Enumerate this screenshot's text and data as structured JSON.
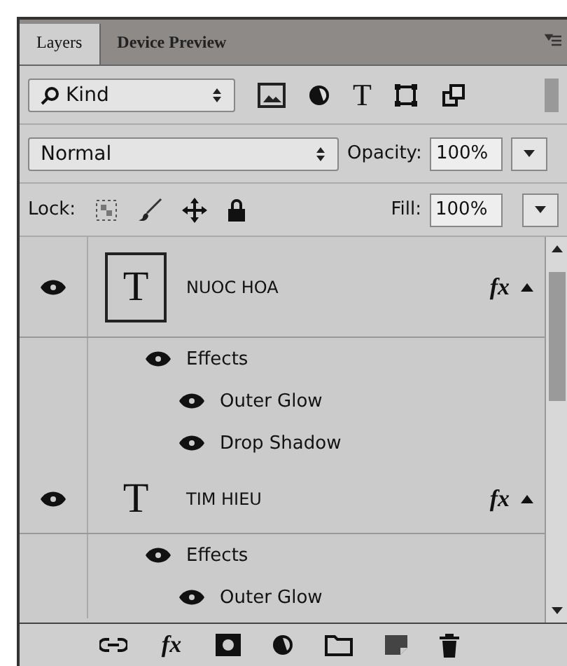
{
  "tabs": [
    {
      "label": "Layers",
      "selected": true
    },
    {
      "label": "Device Preview",
      "selected": false
    }
  ],
  "filter": {
    "value": "Kind",
    "text_icon": "T"
  },
  "blend": {
    "mode": "Normal",
    "opacity_label": "Opacity:",
    "opacity": "100%"
  },
  "lock": {
    "label": "Lock:",
    "fill_label": "Fill:",
    "fill": "100%"
  },
  "layers": [
    {
      "name": "NUOC HOA",
      "thumbnail": "T",
      "visible": true,
      "selected": true,
      "fx": "fx",
      "expanded": true,
      "children": [
        {
          "name": "Effects",
          "visible": true,
          "children": [
            {
              "name": "Outer Glow",
              "visible": true
            },
            {
              "name": "Drop Shadow",
              "visible": true
            }
          ]
        }
      ]
    },
    {
      "name": "TIM HIEU",
      "thumbnail": "T",
      "visible": true,
      "selected": false,
      "fx": "fx",
      "expanded": true,
      "children": [
        {
          "name": "Effects",
          "visible": true,
          "children": [
            {
              "name": "Outer Glow",
              "visible": true
            }
          ]
        }
      ]
    }
  ],
  "toolbar": {
    "fx": "fx"
  }
}
